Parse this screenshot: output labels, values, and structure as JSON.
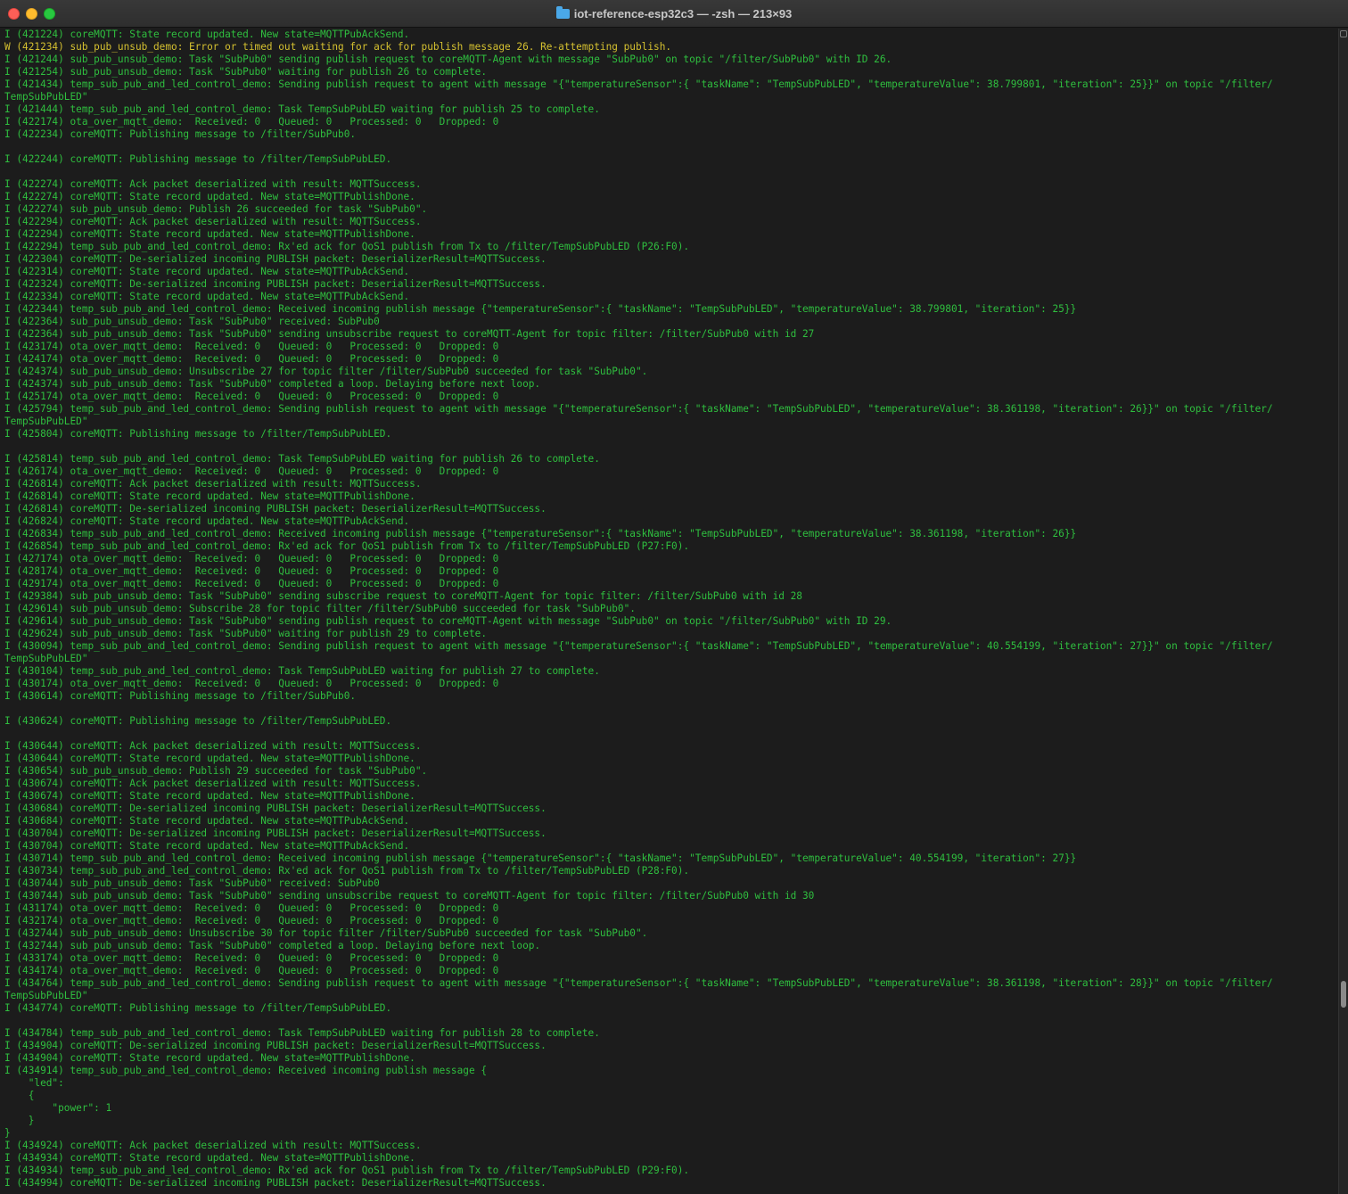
{
  "window": {
    "title": "iot-reference-esp32c3 — -zsh — 213×93",
    "icon": "folder-icon"
  },
  "colors": {
    "info_text": "#2fbf3f",
    "warn_text": "#d4c030",
    "background": "#1c1c1c"
  },
  "lines": [
    {
      "level": "info",
      "text": "I (421224) coreMQTT: State record updated. New state=MQTTPubAckSend."
    },
    {
      "level": "warn",
      "text": "W (421234) sub_pub_unsub_demo: Error or timed out waiting for ack for publish message 26. Re-attempting publish."
    },
    {
      "level": "info",
      "text": "I (421244) sub_pub_unsub_demo: Task \"SubPub0\" sending publish request to coreMQTT-Agent with message \"SubPub0\" on topic \"/filter/SubPub0\" with ID 26."
    },
    {
      "level": "info",
      "text": "I (421254) sub_pub_unsub_demo: Task \"SubPub0\" waiting for publish 26 to complete."
    },
    {
      "level": "info",
      "text": "I (421434) temp_sub_pub_and_led_control_demo: Sending publish request to agent with message \"{\"temperatureSensor\":{ \"taskName\": \"TempSubPubLED\", \"temperatureValue\": 38.799801, \"iteration\": 25}}\" on topic \"/filter/"
    },
    {
      "level": "info",
      "text": "TempSubPubLED\""
    },
    {
      "level": "info",
      "text": "I (421444) temp_sub_pub_and_led_control_demo: Task TempSubPubLED waiting for publish 25 to complete."
    },
    {
      "level": "info",
      "text": "I (422174) ota_over_mqtt_demo:  Received: 0   Queued: 0   Processed: 0   Dropped: 0"
    },
    {
      "level": "info",
      "text": "I (422234) coreMQTT: Publishing message to /filter/SubPub0."
    },
    {
      "level": "info",
      "text": ""
    },
    {
      "level": "info",
      "text": "I (422244) coreMQTT: Publishing message to /filter/TempSubPubLED."
    },
    {
      "level": "info",
      "text": ""
    },
    {
      "level": "info",
      "text": "I (422274) coreMQTT: Ack packet deserialized with result: MQTTSuccess."
    },
    {
      "level": "info",
      "text": "I (422274) coreMQTT: State record updated. New state=MQTTPublishDone."
    },
    {
      "level": "info",
      "text": "I (422274) sub_pub_unsub_demo: Publish 26 succeeded for task \"SubPub0\"."
    },
    {
      "level": "info",
      "text": "I (422294) coreMQTT: Ack packet deserialized with result: MQTTSuccess."
    },
    {
      "level": "info",
      "text": "I (422294) coreMQTT: State record updated. New state=MQTTPublishDone."
    },
    {
      "level": "info",
      "text": "I (422294) temp_sub_pub_and_led_control_demo: Rx'ed ack for QoS1 publish from Tx to /filter/TempSubPubLED (P26:F0)."
    },
    {
      "level": "info",
      "text": "I (422304) coreMQTT: De-serialized incoming PUBLISH packet: DeserializerResult=MQTTSuccess."
    },
    {
      "level": "info",
      "text": "I (422314) coreMQTT: State record updated. New state=MQTTPubAckSend."
    },
    {
      "level": "info",
      "text": "I (422324) coreMQTT: De-serialized incoming PUBLISH packet: DeserializerResult=MQTTSuccess."
    },
    {
      "level": "info",
      "text": "I (422334) coreMQTT: State record updated. New state=MQTTPubAckSend."
    },
    {
      "level": "info",
      "text": "I (422344) temp_sub_pub_and_led_control_demo: Received incoming publish message {\"temperatureSensor\":{ \"taskName\": \"TempSubPubLED\", \"temperatureValue\": 38.799801, \"iteration\": 25}}"
    },
    {
      "level": "info",
      "text": "I (422364) sub_pub_unsub_demo: Task \"SubPub0\" received: SubPub0"
    },
    {
      "level": "info",
      "text": "I (422364) sub_pub_unsub_demo: Task \"SubPub0\" sending unsubscribe request to coreMQTT-Agent for topic filter: /filter/SubPub0 with id 27"
    },
    {
      "level": "info",
      "text": "I (423174) ota_over_mqtt_demo:  Received: 0   Queued: 0   Processed: 0   Dropped: 0"
    },
    {
      "level": "info",
      "text": "I (424174) ota_over_mqtt_demo:  Received: 0   Queued: 0   Processed: 0   Dropped: 0"
    },
    {
      "level": "info",
      "text": "I (424374) sub_pub_unsub_demo: Unsubscribe 27 for topic filter /filter/SubPub0 succeeded for task \"SubPub0\"."
    },
    {
      "level": "info",
      "text": "I (424374) sub_pub_unsub_demo: Task \"SubPub0\" completed a loop. Delaying before next loop."
    },
    {
      "level": "info",
      "text": "I (425174) ota_over_mqtt_demo:  Received: 0   Queued: 0   Processed: 0   Dropped: 0"
    },
    {
      "level": "info",
      "text": "I (425794) temp_sub_pub_and_led_control_demo: Sending publish request to agent with message \"{\"temperatureSensor\":{ \"taskName\": \"TempSubPubLED\", \"temperatureValue\": 38.361198, \"iteration\": 26}}\" on topic \"/filter/"
    },
    {
      "level": "info",
      "text": "TempSubPubLED\""
    },
    {
      "level": "info",
      "text": "I (425804) coreMQTT: Publishing message to /filter/TempSubPubLED."
    },
    {
      "level": "info",
      "text": ""
    },
    {
      "level": "info",
      "text": "I (425814) temp_sub_pub_and_led_control_demo: Task TempSubPubLED waiting for publish 26 to complete."
    },
    {
      "level": "info",
      "text": "I (426174) ota_over_mqtt_demo:  Received: 0   Queued: 0   Processed: 0   Dropped: 0"
    },
    {
      "level": "info",
      "text": "I (426814) coreMQTT: Ack packet deserialized with result: MQTTSuccess."
    },
    {
      "level": "info",
      "text": "I (426814) coreMQTT: State record updated. New state=MQTTPublishDone."
    },
    {
      "level": "info",
      "text": "I (426814) coreMQTT: De-serialized incoming PUBLISH packet: DeserializerResult=MQTTSuccess."
    },
    {
      "level": "info",
      "text": "I (426824) coreMQTT: State record updated. New state=MQTTPubAckSend."
    },
    {
      "level": "info",
      "text": "I (426834) temp_sub_pub_and_led_control_demo: Received incoming publish message {\"temperatureSensor\":{ \"taskName\": \"TempSubPubLED\", \"temperatureValue\": 38.361198, \"iteration\": 26}}"
    },
    {
      "level": "info",
      "text": "I (426854) temp_sub_pub_and_led_control_demo: Rx'ed ack for QoS1 publish from Tx to /filter/TempSubPubLED (P27:F0)."
    },
    {
      "level": "info",
      "text": "I (427174) ota_over_mqtt_demo:  Received: 0   Queued: 0   Processed: 0   Dropped: 0"
    },
    {
      "level": "info",
      "text": "I (428174) ota_over_mqtt_demo:  Received: 0   Queued: 0   Processed: 0   Dropped: 0"
    },
    {
      "level": "info",
      "text": "I (429174) ota_over_mqtt_demo:  Received: 0   Queued: 0   Processed: 0   Dropped: 0"
    },
    {
      "level": "info",
      "text": "I (429384) sub_pub_unsub_demo: Task \"SubPub0\" sending subscribe request to coreMQTT-Agent for topic filter: /filter/SubPub0 with id 28"
    },
    {
      "level": "info",
      "text": "I (429614) sub_pub_unsub_demo: Subscribe 28 for topic filter /filter/SubPub0 succeeded for task \"SubPub0\"."
    },
    {
      "level": "info",
      "text": "I (429614) sub_pub_unsub_demo: Task \"SubPub0\" sending publish request to coreMQTT-Agent with message \"SubPub0\" on topic \"/filter/SubPub0\" with ID 29."
    },
    {
      "level": "info",
      "text": "I (429624) sub_pub_unsub_demo: Task \"SubPub0\" waiting for publish 29 to complete."
    },
    {
      "level": "info",
      "text": "I (430094) temp_sub_pub_and_led_control_demo: Sending publish request to agent with message \"{\"temperatureSensor\":{ \"taskName\": \"TempSubPubLED\", \"temperatureValue\": 40.554199, \"iteration\": 27}}\" on topic \"/filter/"
    },
    {
      "level": "info",
      "text": "TempSubPubLED\""
    },
    {
      "level": "info",
      "text": "I (430104) temp_sub_pub_and_led_control_demo: Task TempSubPubLED waiting for publish 27 to complete."
    },
    {
      "level": "info",
      "text": "I (430174) ota_over_mqtt_demo:  Received: 0   Queued: 0   Processed: 0   Dropped: 0"
    },
    {
      "level": "info",
      "text": "I (430614) coreMQTT: Publishing message to /filter/SubPub0."
    },
    {
      "level": "info",
      "text": ""
    },
    {
      "level": "info",
      "text": "I (430624) coreMQTT: Publishing message to /filter/TempSubPubLED."
    },
    {
      "level": "info",
      "text": ""
    },
    {
      "level": "info",
      "text": "I (430644) coreMQTT: Ack packet deserialized with result: MQTTSuccess."
    },
    {
      "level": "info",
      "text": "I (430644) coreMQTT: State record updated. New state=MQTTPublishDone."
    },
    {
      "level": "info",
      "text": "I (430654) sub_pub_unsub_demo: Publish 29 succeeded for task \"SubPub0\"."
    },
    {
      "level": "info",
      "text": "I (430674) coreMQTT: Ack packet deserialized with result: MQTTSuccess."
    },
    {
      "level": "info",
      "text": "I (430674) coreMQTT: State record updated. New state=MQTTPublishDone."
    },
    {
      "level": "info",
      "text": "I (430684) coreMQTT: De-serialized incoming PUBLISH packet: DeserializerResult=MQTTSuccess."
    },
    {
      "level": "info",
      "text": "I (430684) coreMQTT: State record updated. New state=MQTTPubAckSend."
    },
    {
      "level": "info",
      "text": "I (430704) coreMQTT: De-serialized incoming PUBLISH packet: DeserializerResult=MQTTSuccess."
    },
    {
      "level": "info",
      "text": "I (430704) coreMQTT: State record updated. New state=MQTTPubAckSend."
    },
    {
      "level": "info",
      "text": "I (430714) temp_sub_pub_and_led_control_demo: Received incoming publish message {\"temperatureSensor\":{ \"taskName\": \"TempSubPubLED\", \"temperatureValue\": 40.554199, \"iteration\": 27}}"
    },
    {
      "level": "info",
      "text": "I (430734) temp_sub_pub_and_led_control_demo: Rx'ed ack for QoS1 publish from Tx to /filter/TempSubPubLED (P28:F0)."
    },
    {
      "level": "info",
      "text": "I (430744) sub_pub_unsub_demo: Task \"SubPub0\" received: SubPub0"
    },
    {
      "level": "info",
      "text": "I (430744) sub_pub_unsub_demo: Task \"SubPub0\" sending unsubscribe request to coreMQTT-Agent for topic filter: /filter/SubPub0 with id 30"
    },
    {
      "level": "info",
      "text": "I (431174) ota_over_mqtt_demo:  Received: 0   Queued: 0   Processed: 0   Dropped: 0"
    },
    {
      "level": "info",
      "text": "I (432174) ota_over_mqtt_demo:  Received: 0   Queued: 0   Processed: 0   Dropped: 0"
    },
    {
      "level": "info",
      "text": "I (432744) sub_pub_unsub_demo: Unsubscribe 30 for topic filter /filter/SubPub0 succeeded for task \"SubPub0\"."
    },
    {
      "level": "info",
      "text": "I (432744) sub_pub_unsub_demo: Task \"SubPub0\" completed a loop. Delaying before next loop."
    },
    {
      "level": "info",
      "text": "I (433174) ota_over_mqtt_demo:  Received: 0   Queued: 0   Processed: 0   Dropped: 0"
    },
    {
      "level": "info",
      "text": "I (434174) ota_over_mqtt_demo:  Received: 0   Queued: 0   Processed: 0   Dropped: 0"
    },
    {
      "level": "info",
      "text": "I (434764) temp_sub_pub_and_led_control_demo: Sending publish request to agent with message \"{\"temperatureSensor\":{ \"taskName\": \"TempSubPubLED\", \"temperatureValue\": 38.361198, \"iteration\": 28}}\" on topic \"/filter/"
    },
    {
      "level": "info",
      "text": "TempSubPubLED\""
    },
    {
      "level": "info",
      "text": "I (434774) coreMQTT: Publishing message to /filter/TempSubPubLED."
    },
    {
      "level": "info",
      "text": ""
    },
    {
      "level": "info",
      "text": "I (434784) temp_sub_pub_and_led_control_demo: Task TempSubPubLED waiting for publish 28 to complete."
    },
    {
      "level": "info",
      "text": "I (434904) coreMQTT: De-serialized incoming PUBLISH packet: DeserializerResult=MQTTSuccess."
    },
    {
      "level": "info",
      "text": "I (434904) coreMQTT: State record updated. New state=MQTTPublishDone."
    },
    {
      "level": "info",
      "text": "I (434914) temp_sub_pub_and_led_control_demo: Received incoming publish message {"
    },
    {
      "level": "info",
      "text": "    \"led\":"
    },
    {
      "level": "info",
      "text": "    {"
    },
    {
      "level": "info",
      "text": "        \"power\": 1"
    },
    {
      "level": "info",
      "text": "    }"
    },
    {
      "level": "info",
      "text": "}"
    },
    {
      "level": "info",
      "text": "I (434924) coreMQTT: Ack packet deserialized with result: MQTTSuccess."
    },
    {
      "level": "info",
      "text": "I (434934) coreMQTT: State record updated. New state=MQTTPublishDone."
    },
    {
      "level": "info",
      "text": "I (434934) temp_sub_pub_and_led_control_demo: Rx'ed ack for QoS1 publish from Tx to /filter/TempSubPubLED (P29:F0)."
    },
    {
      "level": "info",
      "text": "I (434994) coreMQTT: De-serialized incoming PUBLISH packet: DeserializerResult=MQTTSuccess."
    }
  ]
}
